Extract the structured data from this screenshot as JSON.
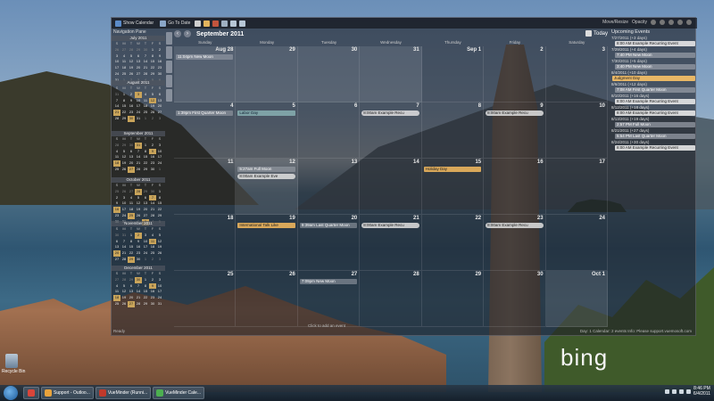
{
  "toolbar": {
    "show_calendar": "Show Calendar",
    "go_to_date": "Go To Date",
    "move_resize": "Move/Resize",
    "opacity": "Opacity"
  },
  "nav_pane": {
    "title": "Navigation Pane",
    "months": [
      {
        "name": "July 2011",
        "dow": [
          "S",
          "M",
          "T",
          "W",
          "T",
          "F",
          "S"
        ],
        "days": [
          "26",
          "27",
          "28",
          "29",
          "30",
          "1",
          "2",
          "3",
          "4",
          "5",
          "6",
          "7",
          "8",
          "9",
          "10",
          "11",
          "12",
          "13",
          "14",
          "15",
          "16",
          "17",
          "18",
          "19",
          "20",
          "21",
          "22",
          "23",
          "24",
          "25",
          "26",
          "27",
          "28",
          "29",
          "30",
          "31",
          "1",
          "2",
          "3",
          "4",
          "5",
          "6"
        ]
      },
      {
        "name": "August 2011",
        "dow": [
          "S",
          "M",
          "T",
          "W",
          "T",
          "F",
          "S"
        ],
        "days": [
          "31",
          "1",
          "2",
          "3",
          "4",
          "5",
          "6",
          "7",
          "8",
          "9",
          "10",
          "11",
          "12",
          "13",
          "14",
          "15",
          "16",
          "17",
          "18",
          "19",
          "20",
          "21",
          "22",
          "23",
          "24",
          "25",
          "26",
          "27",
          "28",
          "29",
          "30",
          "31",
          "1",
          "2",
          "3"
        ]
      },
      {
        "name": "September 2011",
        "dow": [
          "S",
          "M",
          "T",
          "W",
          "T",
          "F",
          "S"
        ],
        "days": [
          "28",
          "29",
          "30",
          "31",
          "1",
          "2",
          "3",
          "4",
          "5",
          "6",
          "7",
          "8",
          "9",
          "10",
          "11",
          "12",
          "13",
          "14",
          "15",
          "16",
          "17",
          "18",
          "19",
          "20",
          "21",
          "22",
          "23",
          "24",
          "25",
          "26",
          "27",
          "28",
          "29",
          "30",
          "1"
        ]
      },
      {
        "name": "October 2011",
        "dow": [
          "S",
          "M",
          "T",
          "W",
          "T",
          "F",
          "S"
        ],
        "days": [
          "25",
          "26",
          "27",
          "28",
          "29",
          "30",
          "1",
          "2",
          "3",
          "4",
          "5",
          "6",
          "7",
          "8",
          "9",
          "10",
          "11",
          "12",
          "13",
          "14",
          "15",
          "16",
          "17",
          "18",
          "19",
          "20",
          "21",
          "22",
          "23",
          "24",
          "25",
          "26",
          "27",
          "28",
          "29",
          "30",
          "31",
          "1",
          "2",
          "3",
          "4",
          "5"
        ]
      },
      {
        "name": "November 2011",
        "dow": [
          "S",
          "M",
          "T",
          "W",
          "T",
          "F",
          "S"
        ],
        "days": [
          "30",
          "31",
          "1",
          "2",
          "3",
          "4",
          "5",
          "6",
          "7",
          "8",
          "9",
          "10",
          "11",
          "12",
          "13",
          "14",
          "15",
          "16",
          "17",
          "18",
          "19",
          "20",
          "21",
          "22",
          "23",
          "24",
          "25",
          "26",
          "27",
          "28",
          "29",
          "30",
          "1",
          "2",
          "3"
        ]
      },
      {
        "name": "December 2011",
        "dow": [
          "S",
          "M",
          "T",
          "W",
          "T",
          "F",
          "S"
        ],
        "days": [
          "27",
          "28",
          "29",
          "30",
          "1",
          "2",
          "3",
          "4",
          "5",
          "6",
          "7",
          "8",
          "9",
          "10",
          "11",
          "12",
          "13",
          "14",
          "15",
          "16",
          "17",
          "18",
          "19",
          "20",
          "21",
          "22",
          "23",
          "24",
          "25",
          "26",
          "27",
          "28",
          "29",
          "30",
          "31"
        ]
      }
    ]
  },
  "calendar": {
    "month_title": "September 2011",
    "today_label": "Today",
    "days_of_week": [
      "Sunday",
      "Monday",
      "Tuesday",
      "Wednesday",
      "Thursday",
      "Friday",
      "Saturday"
    ],
    "weeks": [
      [
        "Aug 28",
        "29",
        "30",
        "31",
        "Sep 1",
        "2",
        "3"
      ],
      [
        "4",
        "5",
        "6",
        "7",
        "8",
        "9",
        "10"
      ],
      [
        "11",
        "12",
        "13",
        "14",
        "15",
        "16",
        "17"
      ],
      [
        "18",
        "19",
        "20",
        "21",
        "22",
        "23",
        "24"
      ],
      [
        "25",
        "26",
        "27",
        "28",
        "29",
        "30",
        "Oct 1"
      ]
    ],
    "events": {
      "w0d0": [
        "11:04pm  New Moon"
      ],
      "w1d0": [
        "1:39pm  First Quarter Moon"
      ],
      "w1d1": [
        "Labor Day"
      ],
      "w1d3": [
        "8:00am  Example Recu"
      ],
      "w1d5": [
        "8:00am  Example Recu"
      ],
      "w2d1": [
        "5:27am  Full Moon",
        "8:00am  Example Eve"
      ],
      "w2d4": [
        "Holiday Day"
      ],
      "w3d1": [
        "International Talk Like"
      ],
      "w3d2": [
        "9:39am  Last Quarter Moon"
      ],
      "w3d3": [
        "8:00am  Example Recu"
      ],
      "w3d5": [
        "8:00am  Example Recu"
      ],
      "w4d2": [
        "7:09pm  New Moon"
      ]
    },
    "click_to_add": "Click to add an event",
    "status_left": "Ready",
    "status_right": "Day: 1 Calendar: 2 events    Info: Please support.vuemosoft.com"
  },
  "upcoming": {
    "title": "Upcoming Events",
    "groups": [
      {
        "date": "7/27/2011 (+3 days)",
        "items": [
          {
            "text": "8:00 AM  Example Recurring Event",
            "style": "light"
          }
        ]
      },
      {
        "date": "7/29/2011 (+4 days)",
        "items": [
          {
            "text": "7:40 PM  New Moon",
            "style": "dark"
          }
        ]
      },
      {
        "date": "7/30/2011 (+5 days)",
        "items": [
          {
            "text": "3:40 PM  New Moon",
            "style": "dark"
          }
        ]
      },
      {
        "date": "8/4/2011 (+10 days)",
        "items": [
          {
            "text": "Judgment Day",
            "style": "orange"
          }
        ]
      },
      {
        "date": "8/6/2011 (+12 days)",
        "items": [
          {
            "text": "7:08 AM  First Quarter Moon",
            "style": "dark"
          }
        ]
      },
      {
        "date": "8/10/2011 (+16 days)",
        "items": [
          {
            "text": "8:00 AM  Example Recurring Event",
            "style": "light"
          }
        ]
      },
      {
        "date": "8/12/2011 (+18 days)",
        "items": [
          {
            "text": "8:00 AM  Example Recurring Event",
            "style": "light"
          }
        ]
      },
      {
        "date": "8/13/2011 (+19 days)",
        "items": [
          {
            "text": "2:57 PM  Full Moon",
            "style": "dark"
          }
        ]
      },
      {
        "date": "8/21/2011 (+27 days)",
        "items": [
          {
            "text": "5:54 PM  Last Quarter Moon",
            "style": "dark"
          }
        ]
      },
      {
        "date": "8/24/2011 (+30 days)",
        "items": [
          {
            "text": "8:00 AM  Example Recurring Event",
            "style": "light"
          }
        ]
      }
    ]
  },
  "desktop": {
    "bing_logo": "bing",
    "recycle_bin": "Recycle Bin"
  },
  "taskbar": {
    "apps": [
      {
        "label": "Support - Outloo...",
        "icon_color": "#e8a33c"
      },
      {
        "label": "VueMinder (Runni...",
        "icon_color": "#c0392b"
      },
      {
        "label": "VueMinder Cale...",
        "icon_color": "#4caf50"
      }
    ],
    "time": "8:46 PM",
    "date": "6/4/2011"
  }
}
